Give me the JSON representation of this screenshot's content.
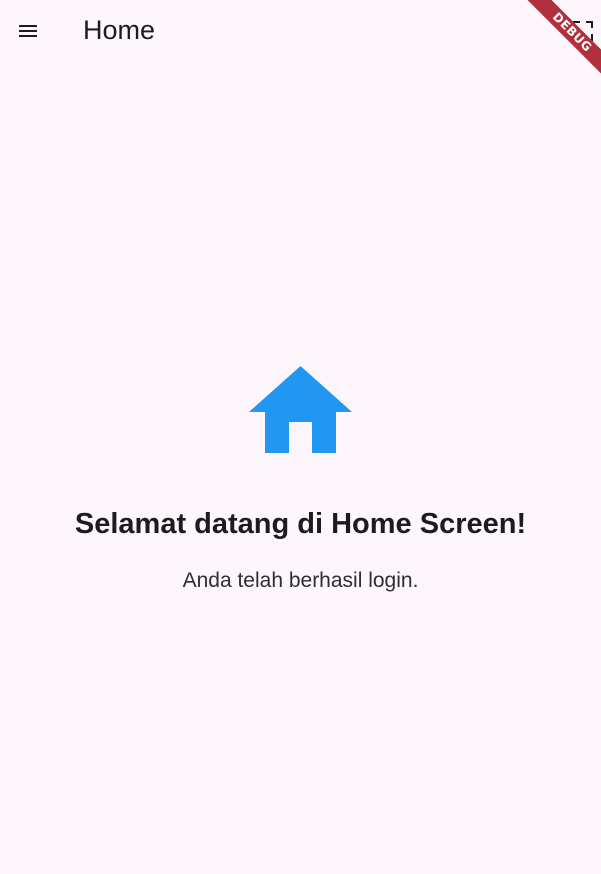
{
  "app_bar": {
    "title": "Home",
    "menu_icon": "menu-icon",
    "action_icon": "fullscreen-icon"
  },
  "debug_banner": {
    "label": "DEBUG",
    "color": "#b0313d"
  },
  "content": {
    "icon": "home-icon",
    "icon_color": "#2196f3",
    "heading": "Selamat datang di Home Screen!",
    "subtitle": "Anda telah berhasil login."
  },
  "colors": {
    "background": "#fdf7fd",
    "text": "#1d1b20"
  }
}
